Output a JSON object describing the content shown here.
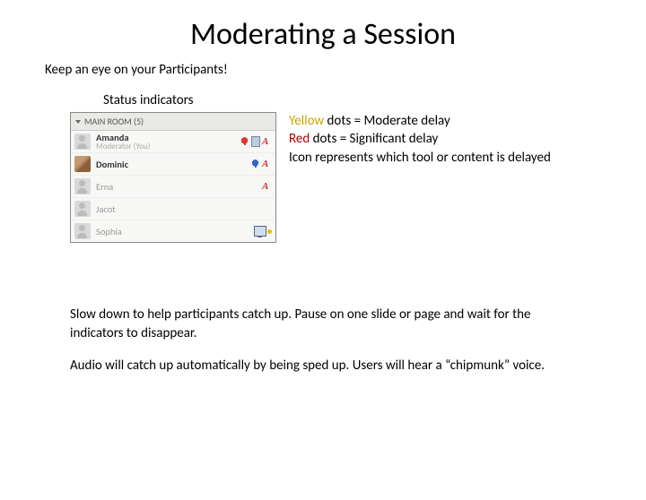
{
  "title": "Moderating a Session",
  "subtitle": "Keep an eye on your Participants!",
  "status_label": "Status indicators",
  "panel": {
    "header": "MAIN ROOM (5)",
    "participants": [
      {
        "name": "Amanda",
        "role": "Moderator (You)",
        "dim": false,
        "photo": false,
        "icons": [
          "mic-red",
          "doc",
          "a-red"
        ]
      },
      {
        "name": "Dominic",
        "role": "",
        "dim": false,
        "photo": true,
        "icons": [
          "mic-blue",
          "a-red"
        ]
      },
      {
        "name": "Erna",
        "role": "",
        "dim": true,
        "photo": false,
        "icons": [
          "a-red"
        ]
      },
      {
        "name": "Jacot",
        "role": "",
        "dim": true,
        "photo": false,
        "icons": []
      },
      {
        "name": "Sophia",
        "role": "",
        "dim": true,
        "photo": false,
        "icons": [
          "monitor-delay"
        ]
      }
    ]
  },
  "legend": {
    "yellow_word": "Yellow",
    "yellow_rest": " dots = Moderate delay",
    "red_word": "Red",
    "red_rest": " dots = Significant delay",
    "icon_line": "Icon represents which tool or content is delayed"
  },
  "para1": "Slow down to help participants catch up.  Pause on one slide or page and wait for the indicators to disappear.",
  "para2": "Audio will catch up automatically by being sped up.  Users will hear a “chipmunk” voice."
}
